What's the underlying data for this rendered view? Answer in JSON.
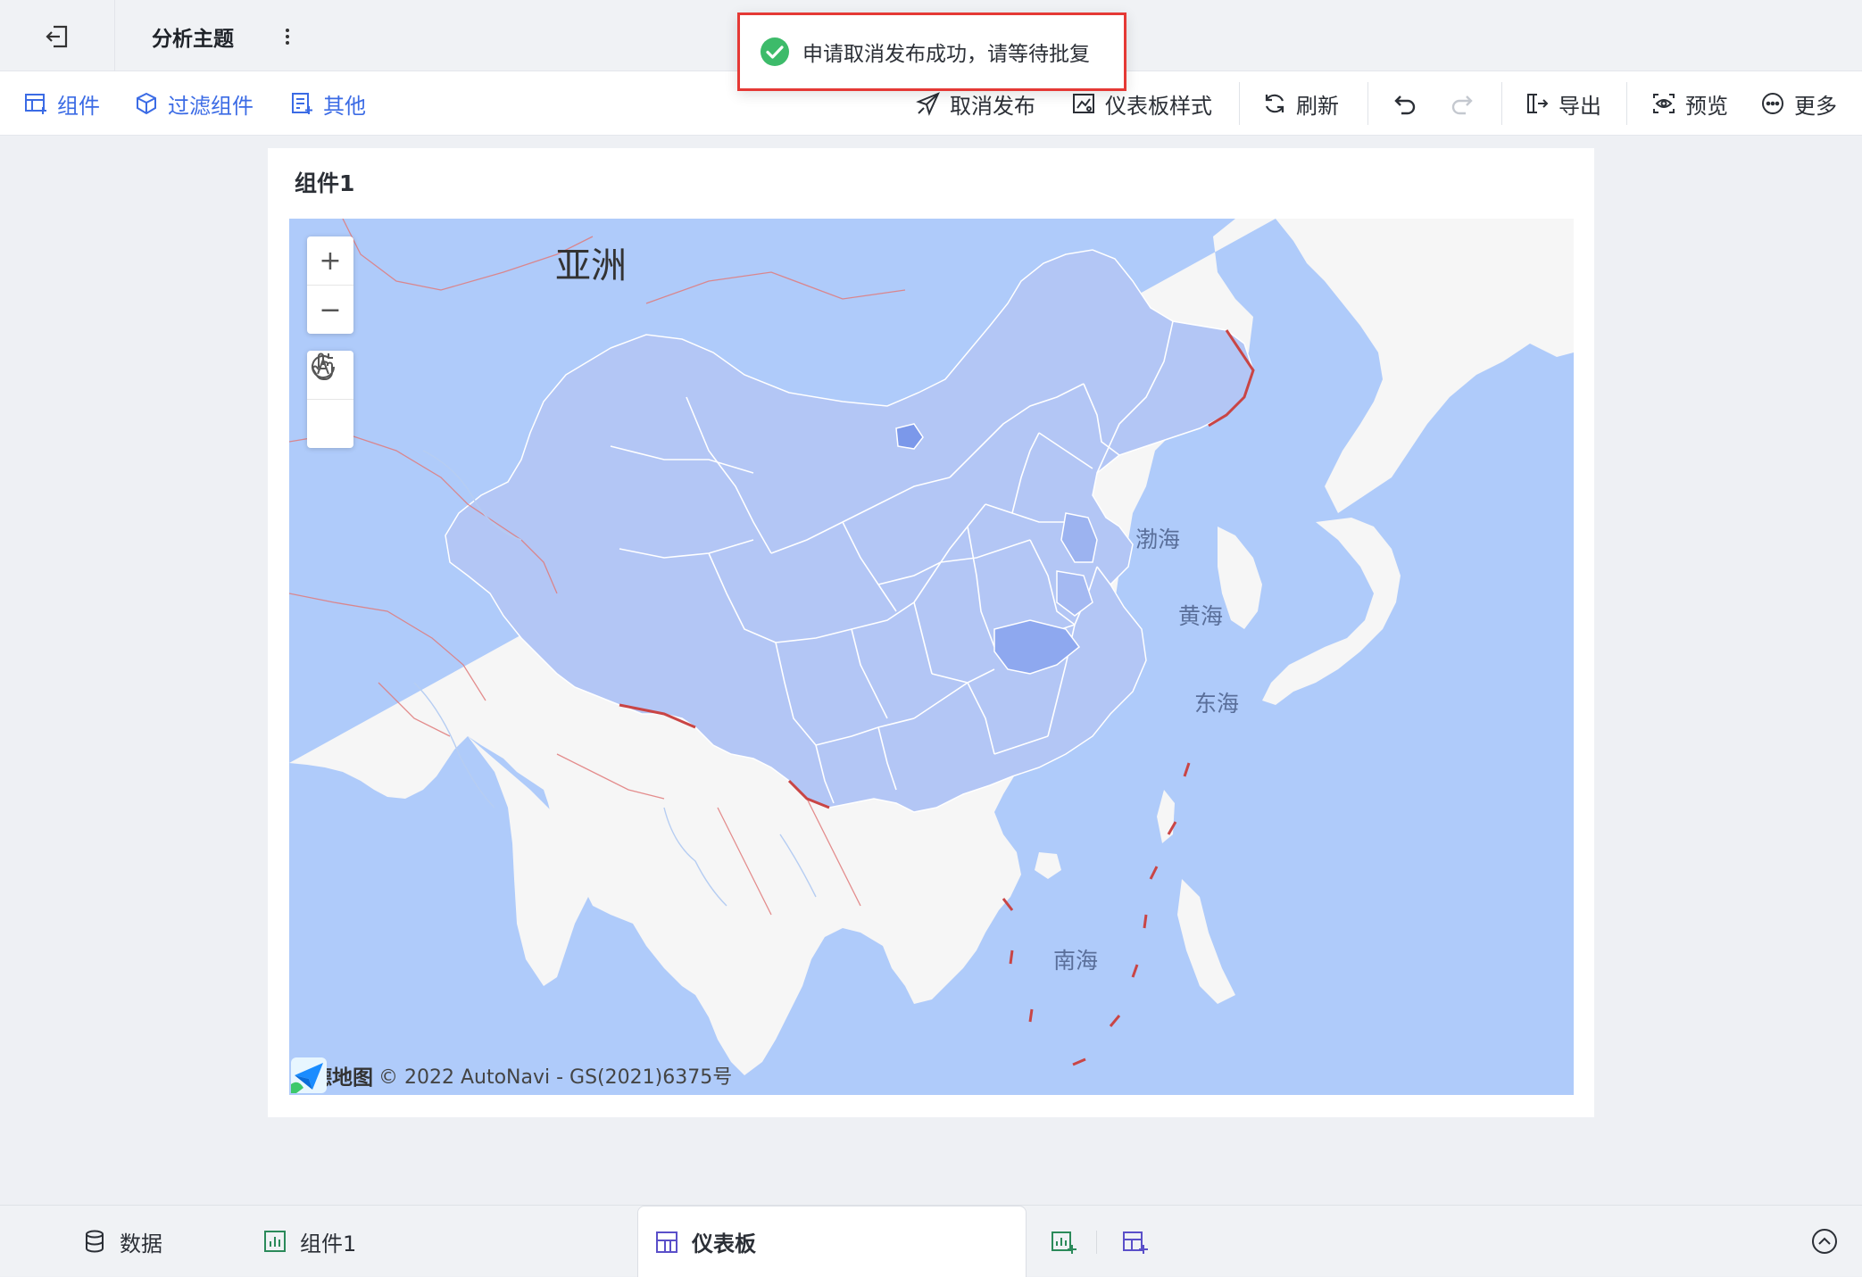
{
  "header": {
    "title": "分析主题"
  },
  "toolbar": {
    "left": {
      "component": "组件",
      "filter_component": "过滤组件",
      "other": "其他"
    },
    "right": {
      "unpublish": "取消发布",
      "dashboard_style": "仪表板样式",
      "refresh": "刷新",
      "export": "导出",
      "preview": "预览",
      "more": "更多"
    }
  },
  "toast": {
    "message": "申请取消发布成功，请等待批复"
  },
  "widget": {
    "title": "组件1",
    "map": {
      "labels": {
        "continent": "亚洲",
        "bohai": "渤海",
        "yellow_sea": "黄海",
        "east_sea": "东海",
        "south_sea": "南海"
      },
      "controls": {
        "zoom_in": "+",
        "zoom_out": "−"
      },
      "attribution": {
        "brand": "高德地图",
        "text": "© 2022 AutoNavi - GS(2021)6375号"
      },
      "colors": {
        "water": "#afcbfa",
        "land": "#f6f6f6",
        "region_fill": "#b3c6f5",
        "region_highlight": "#8ea8ef",
        "border": "#e07a7a"
      }
    }
  },
  "bottom_tabs": {
    "data": "数据",
    "component1": "组件1",
    "dashboard": "仪表板"
  },
  "colors": {
    "accent": "#3b6be5",
    "success": "#3dbb6a",
    "toast_border": "#e53935"
  }
}
